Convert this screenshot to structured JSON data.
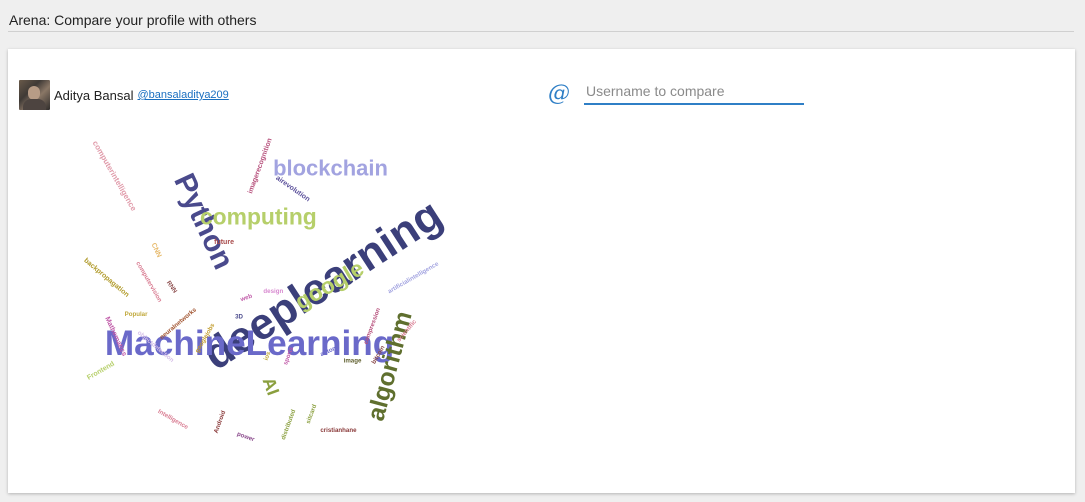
{
  "header": {
    "title": "Arena: Compare your profile with others"
  },
  "profile": {
    "name": "Aditya Bansal",
    "handle": "@bansaladitya209"
  },
  "compare": {
    "at_symbol": "@",
    "placeholder": "Username to compare"
  },
  "wordcloud": {
    "words": [
      {
        "text": "deeplearning",
        "color": "#3b3f7a"
      },
      {
        "text": "MachineLearning",
        "color": "#6a69c9"
      },
      {
        "text": "Python",
        "color": "#4a4a8c"
      },
      {
        "text": "computing",
        "color": "#b6cf6a"
      },
      {
        "text": "blockchain",
        "color": "#a2a3e0"
      },
      {
        "text": "google",
        "color": "#b6cf6a"
      },
      {
        "text": "algorithm",
        "color": "#5f6f2e"
      },
      {
        "text": "AI",
        "color": "#8a9f3e"
      },
      {
        "text": "computerintelligence",
        "color": "#e09aa9"
      },
      {
        "text": "imagerecognition",
        "color": "#b64f7b"
      },
      {
        "text": "airevolution",
        "color": "#5a4f9a"
      },
      {
        "text": "future",
        "color": "#a84a4a"
      },
      {
        "text": "CNN",
        "color": "#e6b96a"
      },
      {
        "text": "backpropagation",
        "color": "#b09a2a"
      },
      {
        "text": "computervision",
        "color": "#d87a90"
      },
      {
        "text": "RNN",
        "color": "#8a4a4a"
      },
      {
        "text": "design",
        "color": "#d88ad0"
      },
      {
        "text": "web",
        "color": "#c05aa8"
      },
      {
        "text": "artificialintelligence",
        "color": "#a2a3e0"
      },
      {
        "text": "Popular",
        "color": "#c0a83a"
      },
      {
        "text": "neuralnetworks",
        "color": "#a0522d"
      },
      {
        "text": "3D",
        "color": "#4a4a8c"
      },
      {
        "text": "Mathematics",
        "color": "#c05aa8"
      },
      {
        "text": "objectdetection",
        "color": "#d6c0e8"
      },
      {
        "text": "googlejobs",
        "color": "#c09a2a"
      },
      {
        "text": "ios",
        "color": "#c0a83a"
      },
      {
        "text": "sports",
        "color": "#c05aa8"
      },
      {
        "text": "automl",
        "color": "#6a69c9"
      },
      {
        "text": "compression",
        "color": "#b64f7b"
      },
      {
        "text": "scientific",
        "color": "#d87a90"
      },
      {
        "text": "image",
        "color": "#5f5f2e"
      },
      {
        "text": "bitcoin",
        "color": "#8a4a4a"
      },
      {
        "text": "Frontend",
        "color": "#b6cf6a"
      },
      {
        "text": "Intelligence",
        "color": "#d87a90"
      },
      {
        "text": "Android",
        "color": "#8a3a3a"
      },
      {
        "text": "power",
        "color": "#8a4a8c"
      },
      {
        "text": "distributed",
        "color": "#8a9f3e"
      },
      {
        "text": "sitcard",
        "color": "#8a9f3e"
      },
      {
        "text": "cristianhane",
        "color": "#8a3a3a"
      }
    ]
  }
}
